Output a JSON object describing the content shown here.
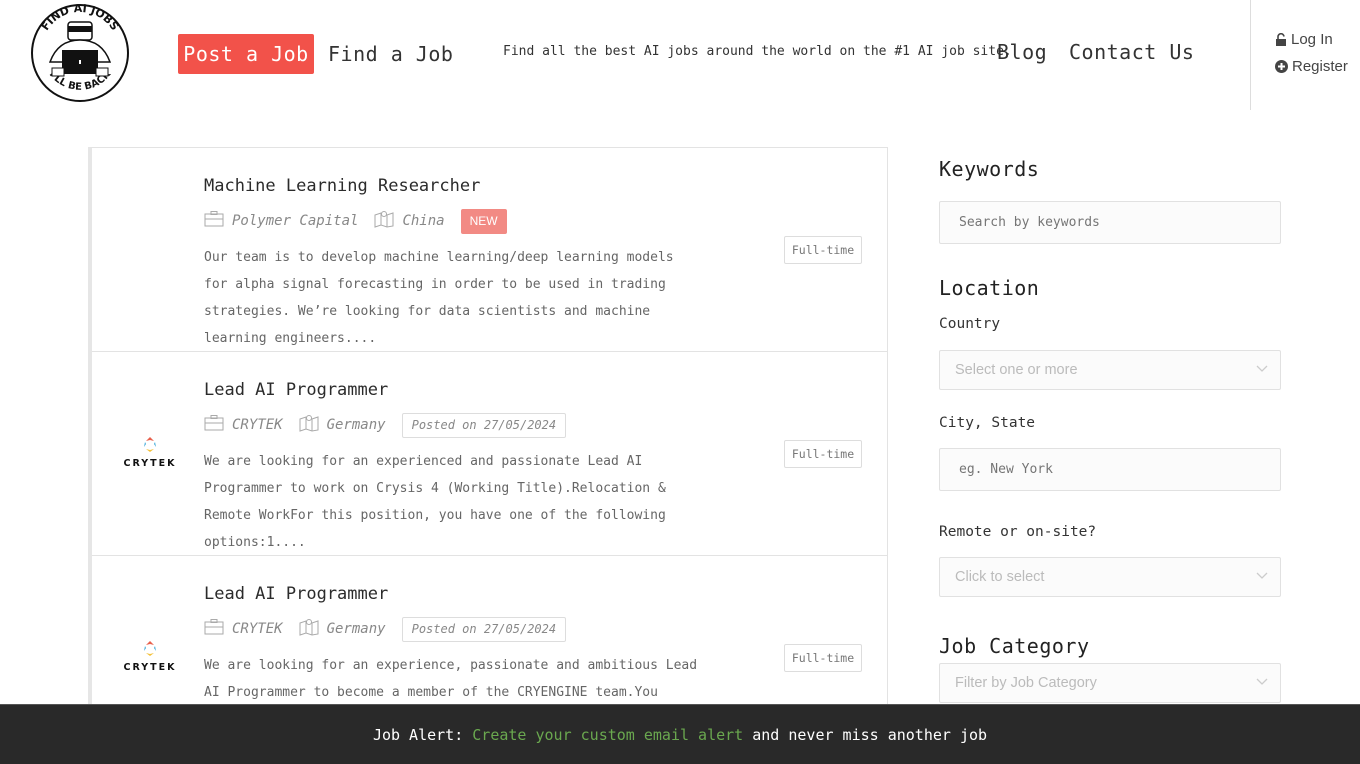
{
  "header": {
    "logo_alt": "Find AI Jobs - I'll Be Back",
    "logo_text_top": "FIND AI JOBS",
    "logo_text_bottom": "I'LL BE BACK",
    "post_job_label": "Post a Job",
    "find_job_label": "Find a Job",
    "tagline": "Find all the best AI jobs around the world on the #1 AI job site.",
    "blog_label": "Blog",
    "contact_label": "Contact Us",
    "login_label": "Log In",
    "register_label": "Register",
    "accent_color": "#f2524a"
  },
  "jobs": [
    {
      "title": "Machine Learning Researcher",
      "company": "Polymer Capital",
      "location": "China",
      "badge": "NEW",
      "description": "Our team is to develop machine learning/deep learning models for alpha signal forecasting in order to be used in trading strategies. We’re looking for data scientists and machine learning engineers....",
      "type": "Full-time",
      "logo": ""
    },
    {
      "title": "Lead AI Programmer",
      "company": "CRYTEK",
      "location": "Germany",
      "badge": "Posted on 27/05/2024",
      "description": "We are looking for an experienced and passionate Lead AI Programmer to work on Crysis 4 (Working Title).Relocation & Remote WorkFor this position, you have one of the following options:1....",
      "type": "Full-time",
      "logo": "CRYTEK"
    },
    {
      "title": "Lead AI Programmer",
      "company": "CRYTEK",
      "location": "Germany",
      "badge": "Posted on 27/05/2024",
      "description": "We are looking for an experience, passionate and ambitious Lead AI Programmer to become a member of the CRYENGINE team.You would",
      "type": "Full-time",
      "logo": "CRYTEK"
    }
  ],
  "sidebar": {
    "keywords_heading": "Keywords",
    "keywords_placeholder": "Search by keywords",
    "location_heading": "Location",
    "country_label": "Country",
    "country_placeholder": "Select one or more",
    "city_label": "City, State",
    "city_placeholder": "eg. New York",
    "remote_label": "Remote or on-site?",
    "remote_placeholder": "Click to select",
    "category_heading": "Job Category",
    "category_placeholder": "Filter by Job Category"
  },
  "alert_bar": {
    "prefix": "Job Alert:",
    "link": "Create your custom email alert",
    "suffix": "and never miss another job",
    "link_color": "#6aa84f"
  }
}
